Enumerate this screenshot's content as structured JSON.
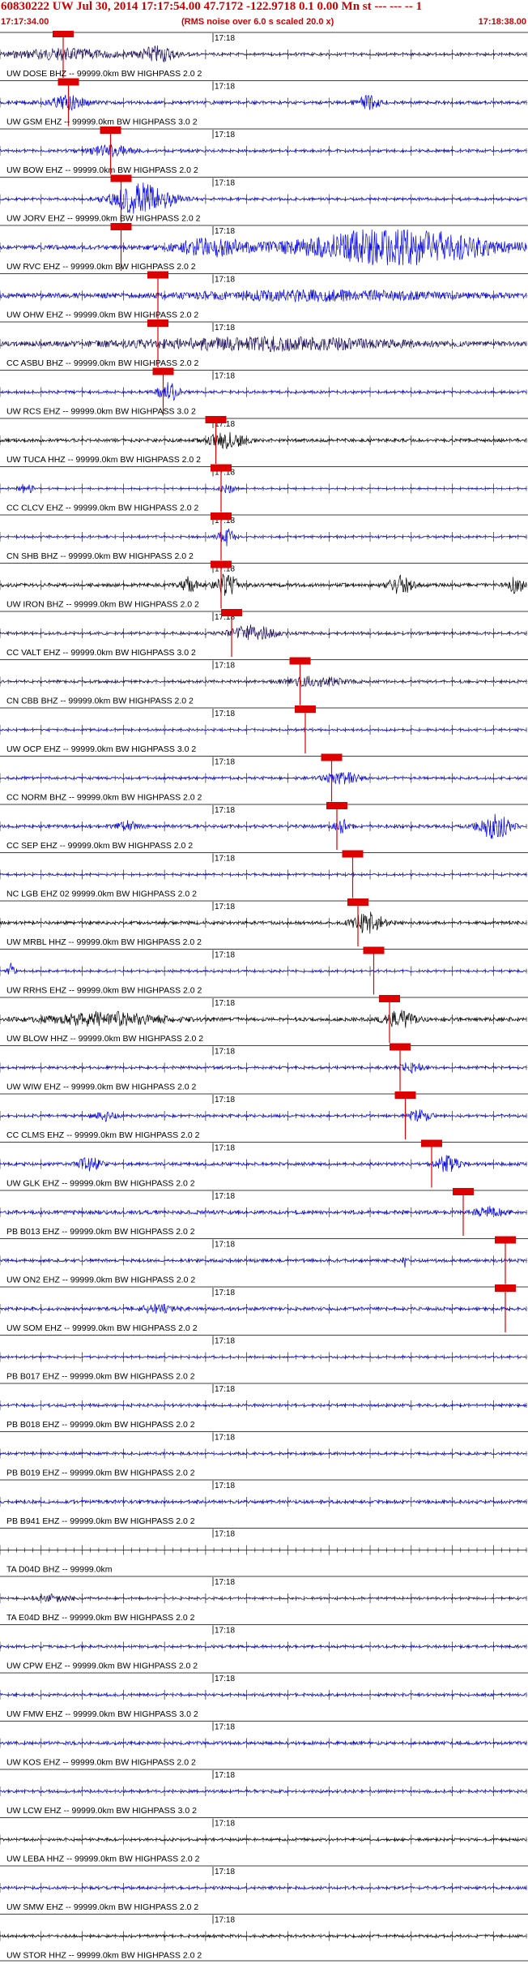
{
  "header": {
    "title": "60830222 UW Jul 30, 2014 17:17:54.00   47.7172 -122.9718  0.1 0.00 Mn st --- --- --  1",
    "start_time": "17:17:34.00",
    "note": "(RMS noise over 6.0 s scaled 20.0 x)",
    "end_time": "17:18:38.00"
  },
  "chart_data": {
    "type": "seismogram",
    "time_window": [
      "17:17:34.00",
      "17:18:38.00"
    ],
    "minute_label": "17:18",
    "traces": [
      {
        "label": "UW DOSE BHZ -- 99999.0km BW  HIGHPASS  2.0  2",
        "color": "#1a0a5c",
        "pick": 0.12,
        "amp": 0.5,
        "bursts": [
          [
            0.12,
            0.15,
            2.0
          ],
          [
            0.3,
            0.05,
            3.0
          ]
        ]
      },
      {
        "label": "UW GSM EHZ -- 99999.0km BW  HIGHPASS  3.0  2",
        "color": "#0000ee",
        "pick": 0.13,
        "amp": 0.6,
        "bursts": [
          [
            0.13,
            0.05,
            2.5
          ],
          [
            0.7,
            0.03,
            2.5
          ]
        ]
      },
      {
        "label": "UW BOW EHZ -- 99999.0km BW  HIGHPASS  2.0  2",
        "color": "#0000ee",
        "pick": 0.21,
        "amp": 0.5,
        "bursts": [
          [
            0.21,
            0.06,
            2.0
          ]
        ]
      },
      {
        "label": "UW JORV EHZ -- 99999.0km BW  HIGHPASS  2.0  2",
        "color": "#0000ee",
        "pick": 0.23,
        "amp": 0.5,
        "bursts": [
          [
            0.27,
            0.08,
            6.0
          ]
        ]
      },
      {
        "label": "UW RVC EHZ -- 99999.0km BW  HIGHPASS  2.0  2",
        "color": "#0000ee",
        "pick": 0.23,
        "amp": 0.8,
        "bursts": [
          [
            0.75,
            0.25,
            7.0
          ],
          [
            0.4,
            0.1,
            3.0
          ]
        ]
      },
      {
        "label": "UW OHW EHZ -- 99999.0km BW  HIGHPASS  2.0  2",
        "color": "#0000ee",
        "pick": 0.3,
        "amp": 1.0,
        "bursts": [
          [
            0.6,
            0.3,
            1.6
          ]
        ]
      },
      {
        "label": "CC ASBU BHZ -- 99999.0km BW  HIGHPASS  2.0  2",
        "color": "#1a0a5c",
        "pick": 0.3,
        "amp": 0.9,
        "bursts": [
          [
            0.5,
            0.35,
            2.2
          ]
        ]
      },
      {
        "label": "UW RCS EHZ -- 99999.0km BW  HIGHPASS  3.0  2",
        "color": "#0000ee",
        "pick": 0.31,
        "amp": 0.5,
        "bursts": [
          [
            0.32,
            0.03,
            3.5
          ]
        ]
      },
      {
        "label": "UW TUCA HHZ -- 99999.0km BW  HIGHPASS  2.0  2",
        "color": "#000000",
        "pick": 0.41,
        "amp": 0.6,
        "bursts": [
          [
            0.43,
            0.05,
            3.0
          ]
        ]
      },
      {
        "label": "CC CLCV EHZ -- 99999.0km BW  HIGHPASS  2.0  2",
        "color": "#0000ee",
        "pick": 0.42,
        "amp": 0.3,
        "bursts": [
          [
            0.05,
            0.02,
            2.0
          ],
          [
            0.43,
            0.02,
            2.0
          ]
        ]
      },
      {
        "label": "CN SHB BHZ -- 99999.0km BW  HIGHPASS  2.0  2",
        "color": "#0000ee",
        "pick": 0.42,
        "amp": 0.4,
        "bursts": [
          [
            0.43,
            0.02,
            3.5
          ]
        ]
      },
      {
        "label": "UW IRON BHZ -- 99999.0km BW  HIGHPASS  2.0  2",
        "color": "#000000",
        "pick": 0.42,
        "amp": 0.7,
        "bursts": [
          [
            0.43,
            0.03,
            4.0
          ],
          [
            0.36,
            0.02,
            3.0
          ],
          [
            0.76,
            0.03,
            3.5
          ],
          [
            0.98,
            0.02,
            3.0
          ]
        ]
      },
      {
        "label": "CC VALT EHZ -- 99999.0km BW  HIGHPASS  3.0  2",
        "color": "#1a0a5c",
        "pick": 0.44,
        "amp": 0.5,
        "bursts": [
          [
            0.48,
            0.06,
            3.0
          ]
        ]
      },
      {
        "label": "CN CBB BHZ -- 99999.0km BW  HIGHPASS  2.0  2",
        "color": "#1a0a5c",
        "pick": 0.57,
        "amp": 0.5,
        "bursts": [
          [
            0.6,
            0.08,
            1.8
          ]
        ]
      },
      {
        "label": "UW OCP EHZ -- 99999.0km BW  HIGHPASS  3.0  2",
        "color": "#0000ee",
        "pick": 0.58,
        "amp": 0.4,
        "bursts": []
      },
      {
        "label": "CC NORM BHZ -- 99999.0km BW  HIGHPASS  2.0  2",
        "color": "#0000ee",
        "pick": 0.63,
        "amp": 0.5,
        "bursts": [
          [
            0.65,
            0.05,
            2.0
          ]
        ]
      },
      {
        "label": "CC SEP EHZ -- 99999.0km BW  HIGHPASS  2.0  2",
        "color": "#0000ee",
        "pick": 0.64,
        "amp": 0.6,
        "bursts": [
          [
            0.65,
            0.02,
            2.5
          ],
          [
            0.94,
            0.04,
            5.0
          ],
          [
            0.24,
            0.03,
            1.8
          ]
        ]
      },
      {
        "label": "NC LGB EHZ 02 99999.0km BW  HIGHPASS  2.0  2",
        "color": "#0000ee",
        "pick": 0.67,
        "amp": 0.4,
        "bursts": []
      },
      {
        "label": "UW MRBL HHZ -- 99999.0km BW  HIGHPASS  2.0  2",
        "color": "#000000",
        "pick": 0.68,
        "amp": 0.6,
        "bursts": [
          [
            0.7,
            0.04,
            4.0
          ]
        ]
      },
      {
        "label": "UW RRHS EHZ -- 99999.0km BW  HIGHPASS  2.0  2",
        "color": "#0000ee",
        "pick": 0.71,
        "amp": 0.4,
        "bursts": [
          [
            0.02,
            0.01,
            3.0
          ]
        ]
      },
      {
        "label": "UW BLOW HHZ -- 99999.0km BW  HIGHPASS  2.0  2",
        "color": "#000000",
        "pick": 0.74,
        "amp": 0.7,
        "bursts": [
          [
            0.2,
            0.15,
            2.5
          ],
          [
            0.76,
            0.04,
            3.0
          ]
        ]
      },
      {
        "label": "UW WIW EHZ -- 99999.0km BW  HIGHPASS  2.0  2",
        "color": "#0000ee",
        "pick": 0.76,
        "amp": 0.5,
        "bursts": [
          [
            0.78,
            0.03,
            2.0
          ]
        ]
      },
      {
        "label": "CC CLMS EHZ -- 99999.0km BW  HIGHPASS  2.0  2",
        "color": "#0000ee",
        "pick": 0.77,
        "amp": 0.5,
        "bursts": [
          [
            0.2,
            0.03,
            1.8
          ],
          [
            0.8,
            0.03,
            2.0
          ]
        ]
      },
      {
        "label": "UW GLK EHZ -- 99999.0km BW  HIGHPASS  2.0  2",
        "color": "#0000ee",
        "pick": 0.82,
        "amp": 0.6,
        "bursts": [
          [
            0.17,
            0.03,
            2.5
          ],
          [
            0.85,
            0.03,
            3.0
          ]
        ]
      },
      {
        "label": "PB B013 EHZ -- 99999.0km BW  HIGHPASS  2.0  2",
        "color": "#0000ee",
        "pick": 0.88,
        "amp": 0.7,
        "bursts": [
          [
            0.93,
            0.04,
            2.0
          ]
        ]
      },
      {
        "label": "UW ON2 EHZ -- 99999.0km BW  HIGHPASS  2.0  2",
        "color": "#0000ee",
        "pick": 0.96,
        "amp": 0.6,
        "bursts": [
          [
            0.77,
            0.005,
            3.0
          ]
        ]
      },
      {
        "label": "UW SOM EHZ -- 99999.0km BW  HIGHPASS  2.0  2",
        "color": "#0000ee",
        "pick": 0.96,
        "amp": 0.6,
        "bursts": [
          [
            0.3,
            0.05,
            1.5
          ]
        ]
      },
      {
        "label": "PB B017 EHZ -- 99999.0km BW  HIGHPASS  2.0  2",
        "color": "#0000ee",
        "pick": null,
        "amp": 0.4,
        "bursts": []
      },
      {
        "label": "PB B018 EHZ -- 99999.0km BW  HIGHPASS  2.0  2",
        "color": "#0000ee",
        "pick": null,
        "amp": 0.5,
        "bursts": []
      },
      {
        "label": "PB B019 EHZ -- 99999.0km BW  HIGHPASS  2.0  2",
        "color": "#0000ee",
        "pick": null,
        "amp": 0.5,
        "bursts": []
      },
      {
        "label": "PB B941 EHZ -- 99999.0km BW  HIGHPASS  2.0  2",
        "color": "#0000ee",
        "pick": null,
        "amp": 0.6,
        "bursts": []
      },
      {
        "label": "TA D04D BHZ -- 99999.0km",
        "color": "#1a0a5c",
        "pick": null,
        "amp": 0.0,
        "bursts": []
      },
      {
        "label": "TA E04D BHZ -- 99999.0km BW  HIGHPASS  2.0  2",
        "color": "#1a0a5c",
        "pick": null,
        "amp": 0.4,
        "bursts": [
          [
            0.1,
            0.05,
            1.4
          ]
        ]
      },
      {
        "label": "UW CPW EHZ -- 99999.0km BW  HIGHPASS  2.0  2",
        "color": "#0000ee",
        "pick": null,
        "amp": 0.5,
        "bursts": []
      },
      {
        "label": "UW FMW EHZ -- 99999.0km BW  HIGHPASS  3.0  2",
        "color": "#0000ee",
        "pick": null,
        "amp": 0.5,
        "bursts": []
      },
      {
        "label": "UW KOS EHZ -- 99999.0km BW  HIGHPASS  2.0  2",
        "color": "#0000ee",
        "pick": null,
        "amp": 0.6,
        "bursts": []
      },
      {
        "label": "UW LCW EHZ -- 99999.0km BW  HIGHPASS  3.0  2",
        "color": "#0000ee",
        "pick": null,
        "amp": 0.5,
        "bursts": []
      },
      {
        "label": "UW LEBA HHZ -- 99999.0km BW  HIGHPASS  2.0  2",
        "color": "#000000",
        "pick": null,
        "amp": 0.5,
        "bursts": []
      },
      {
        "label": "UW SMW EHZ -- 99999.0km BW  HIGHPASS  2.0  2",
        "color": "#0000ee",
        "pick": null,
        "amp": 0.5,
        "bursts": []
      },
      {
        "label": "UW STOR HHZ -- 99999.0km BW  HIGHPASS  2.0  2",
        "color": "#000000",
        "pick": null,
        "amp": 0.5,
        "bursts": []
      }
    ]
  }
}
